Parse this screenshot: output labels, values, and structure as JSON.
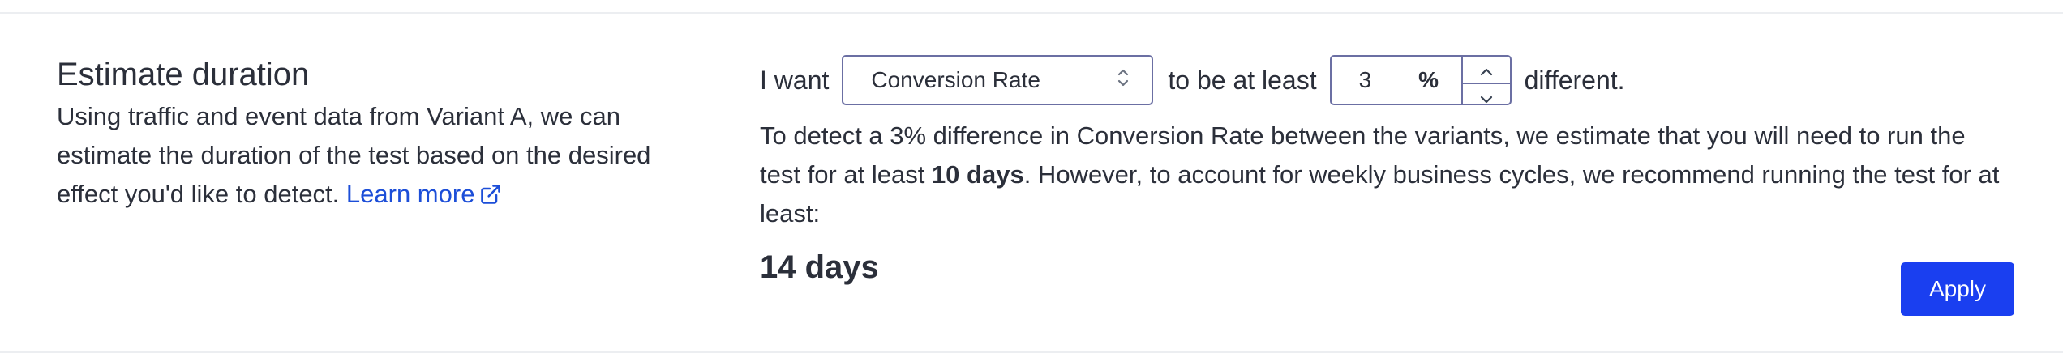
{
  "section": {
    "title": "Estimate duration",
    "description": "Using traffic and event data from Variant A, we can estimate the duration of the test based on the desired effect you'd like to detect.",
    "learn_more": "Learn more"
  },
  "controls": {
    "prefix": "I want",
    "metric_selected": "Conversion Rate",
    "middle": "to be at least",
    "threshold_value": "3",
    "threshold_unit": "%",
    "suffix": "different."
  },
  "estimate": {
    "text_part1": "To detect a 3% difference in Conversion Rate between the variants, we estimate that you will need to run the test for at least ",
    "text_bold": "10 days",
    "text_part2": ". However, to account for weekly business cycles, we recommend running the test for at least:",
    "result": "14 days"
  },
  "actions": {
    "apply_label": "Apply"
  },
  "colors": {
    "accent": "#1a3ff0",
    "link": "#1c4ed8",
    "text": "#2b2f3a",
    "input_border": "#6b6fa3"
  },
  "icons": {
    "learn_more": "external-link-icon",
    "select": "chevron-up-down-icon",
    "step_up": "chevron-up-icon",
    "step_down": "chevron-down-icon"
  }
}
